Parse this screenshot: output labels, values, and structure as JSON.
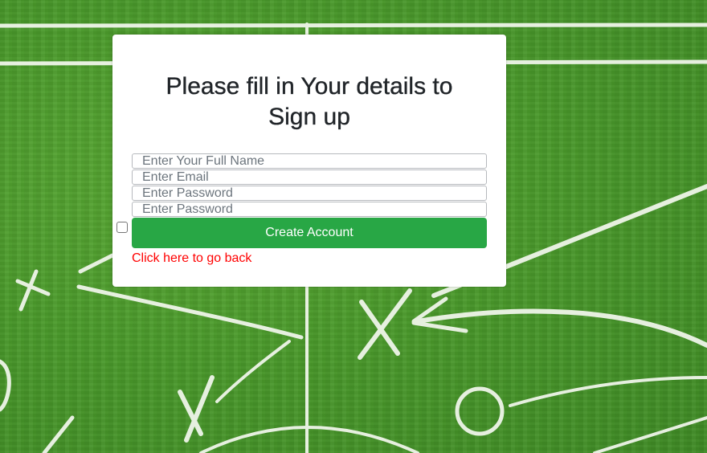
{
  "form": {
    "title_line1": "Please fill in Your details to",
    "title_line2": "Sign up",
    "full_name_placeholder": "Enter Your Full Name",
    "email_placeholder": "Enter Email",
    "password_placeholder": "Enter Password",
    "confirm_password_placeholder": "Enter Password",
    "submit_label": "Create Account",
    "back_link_label": "Click here to go back"
  },
  "colors": {
    "button": "#28a745",
    "link": "#ff0000",
    "field": "#4e9a2c"
  }
}
